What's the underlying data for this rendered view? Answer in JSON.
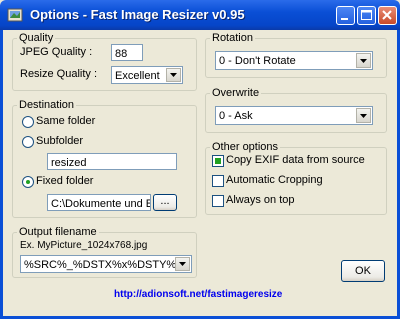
{
  "window": {
    "title": "Options - Fast Image Resizer v0.95"
  },
  "quality": {
    "legend": "Quality",
    "jpeg_label": "JPEG Quality :",
    "jpeg_value": "88",
    "resize_label": "Resize Quality :",
    "resize_value": "Excellent"
  },
  "destination": {
    "legend": "Destination",
    "same_folder": "Same folder",
    "subfolder": "Subfolder",
    "subfolder_value": "resized",
    "fixed_folder": "Fixed folder",
    "fixed_folder_value": "C:\\Dokumente und E",
    "browse_label": "..."
  },
  "output": {
    "legend": "Output filename",
    "example": "Ex. MyPicture_1024x768.jpg",
    "pattern_value": "%SRC%_%DSTX%x%DSTY%"
  },
  "rotation": {
    "legend": "Rotation",
    "value": "0 - Don't Rotate"
  },
  "overwrite": {
    "legend": "Overwrite",
    "value": "0 - Ask"
  },
  "other": {
    "legend": "Other options",
    "copy_exif": "Copy EXIF data from source",
    "auto_crop": "Automatic Cropping",
    "always_on_top": "Always on top"
  },
  "ok_label": "OK",
  "link_text": "http://adionsoft.net/fastimageresize"
}
